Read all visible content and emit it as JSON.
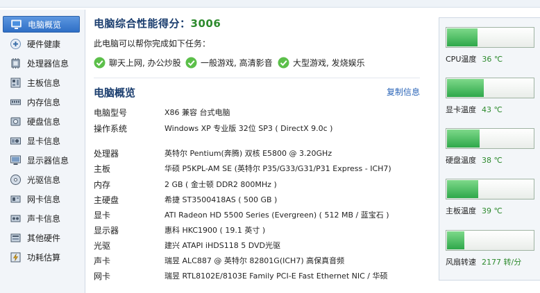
{
  "sidebar": {
    "items": [
      {
        "label": "电脑概览",
        "icon": "monitor-icon",
        "active": true
      },
      {
        "label": "硬件健康",
        "icon": "plus-circle-icon"
      },
      {
        "label": "处理器信息",
        "icon": "cpu-icon"
      },
      {
        "label": "主板信息",
        "icon": "motherboard-icon"
      },
      {
        "label": "内存信息",
        "icon": "memory-icon"
      },
      {
        "label": "硬盘信息",
        "icon": "harddisk-icon"
      },
      {
        "label": "显卡信息",
        "icon": "graphics-card-icon"
      },
      {
        "label": "显示器信息",
        "icon": "display-icon"
      },
      {
        "label": "光驱信息",
        "icon": "optical-drive-icon"
      },
      {
        "label": "网卡信息",
        "icon": "network-card-icon"
      },
      {
        "label": "声卡信息",
        "icon": "sound-card-icon"
      },
      {
        "label": "其他硬件",
        "icon": "other-hardware-icon"
      },
      {
        "label": "功耗估算",
        "icon": "power-icon"
      }
    ]
  },
  "score": {
    "label": "电脑综合性能得分：",
    "value": "3006"
  },
  "tasks": {
    "intro": "此电脑可以帮你完成如下任务：",
    "items": [
      "聊天上网, 办公炒股",
      "一般游戏, 高清影音",
      "大型游戏, 发烧娱乐"
    ]
  },
  "overview": {
    "title": "电脑概览",
    "copy_label": "复制信息",
    "rows": [
      {
        "label": "电脑型号",
        "value": "X86 兼容 台式电脑"
      },
      {
        "label": "操作系统",
        "value": "Windows XP 专业版 32位 SP3 ( DirectX 9.0c )"
      },
      {
        "label": "处理器",
        "value": "英特尔 Pentium(奔腾) 双核 E5800 @ 3.20GHz"
      },
      {
        "label": "主板",
        "value": "华硕 P5KPL-AM SE (英特尔 P35/G33/G31/P31 Express - ICH7)"
      },
      {
        "label": "内存",
        "value": "2 GB ( 金士顿 DDR2 800MHz )"
      },
      {
        "label": "主硬盘",
        "value": "希捷 ST3500418AS ( 500 GB )"
      },
      {
        "label": "显卡",
        "value": "ATI Radeon HD 5500 Series (Evergreen) ( 512 MB / 蓝宝石 )"
      },
      {
        "label": "显示器",
        "value": "惠科 HKC1900 ( 19.1 英寸 )"
      },
      {
        "label": "光驱",
        "value": "建兴 ATAPI iHDS118 5 DVD光驱"
      },
      {
        "label": "声卡",
        "value": "瑞昱 ALC887 @ 英特尔 82801G(ICH7) 高保真音频"
      },
      {
        "label": "网卡",
        "value": "瑞昱 RTL8102E/8103E Family PCI-E Fast Ethernet NIC / 华硕"
      }
    ]
  },
  "sensors": [
    {
      "label": "CPU温度",
      "value": "36 ℃",
      "level": 0.35
    },
    {
      "label": "显卡温度",
      "value": "43 ℃",
      "level": 0.42
    },
    {
      "label": "硬盘温度",
      "value": "38 ℃",
      "level": 0.37
    },
    {
      "label": "主板温度",
      "value": "39 ℃",
      "level": 0.36
    },
    {
      "label": "风扇转速",
      "value": "2177 转/分",
      "level": 0.2
    }
  ],
  "colors": {
    "accent": "#2f6fc6",
    "ok": "#2d8a2d",
    "gauge": "#3fb556"
  }
}
